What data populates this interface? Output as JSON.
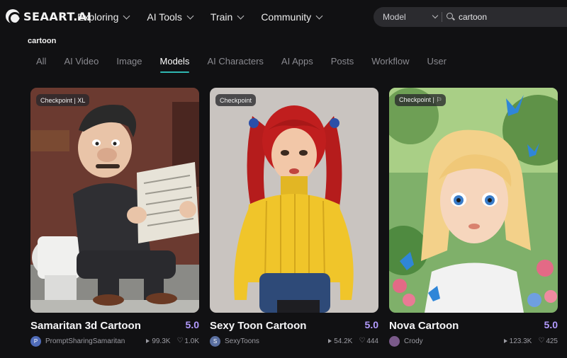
{
  "brand": {
    "logo_text": "SEAART.AI"
  },
  "nav": [
    {
      "label": "Exploring"
    },
    {
      "label": "AI Tools"
    },
    {
      "label": "Train"
    },
    {
      "label": "Community"
    }
  ],
  "search": {
    "type_selected": "Model",
    "query": "cartoon"
  },
  "results_heading": "cartoon",
  "tabs": [
    {
      "label": "All",
      "active": false
    },
    {
      "label": "AI Video",
      "active": false
    },
    {
      "label": "Image",
      "active": false
    },
    {
      "label": "Models",
      "active": true
    },
    {
      "label": "AI Characters",
      "active": false
    },
    {
      "label": "AI Apps",
      "active": false
    },
    {
      "label": "Posts",
      "active": false
    },
    {
      "label": "Workflow",
      "active": false
    },
    {
      "label": "User",
      "active": false
    }
  ],
  "cards": [
    {
      "tag": "Checkpoint | XL",
      "title": "Samaritan 3d Cartoon",
      "score": "5.0",
      "avatar_letter": "P",
      "author": "PromptSharingSamaritan",
      "views": "99.3K",
      "likes": "1.0K"
    },
    {
      "tag": "Checkpoint",
      "title": "Sexy Toon Cartoon",
      "score": "5.0",
      "avatar_letter": "S",
      "author": "SexyToons",
      "views": "54.2K",
      "likes": "444"
    },
    {
      "tag": "Checkpoint | ⚐",
      "title": "Nova Cartoon",
      "score": "5.0",
      "avatar_letter": "",
      "author": "Crody",
      "views": "123.3K",
      "likes": "425"
    }
  ],
  "colors": {
    "accent": "#2fb7b2",
    "score": "#b39bff",
    "background": "#111113"
  }
}
